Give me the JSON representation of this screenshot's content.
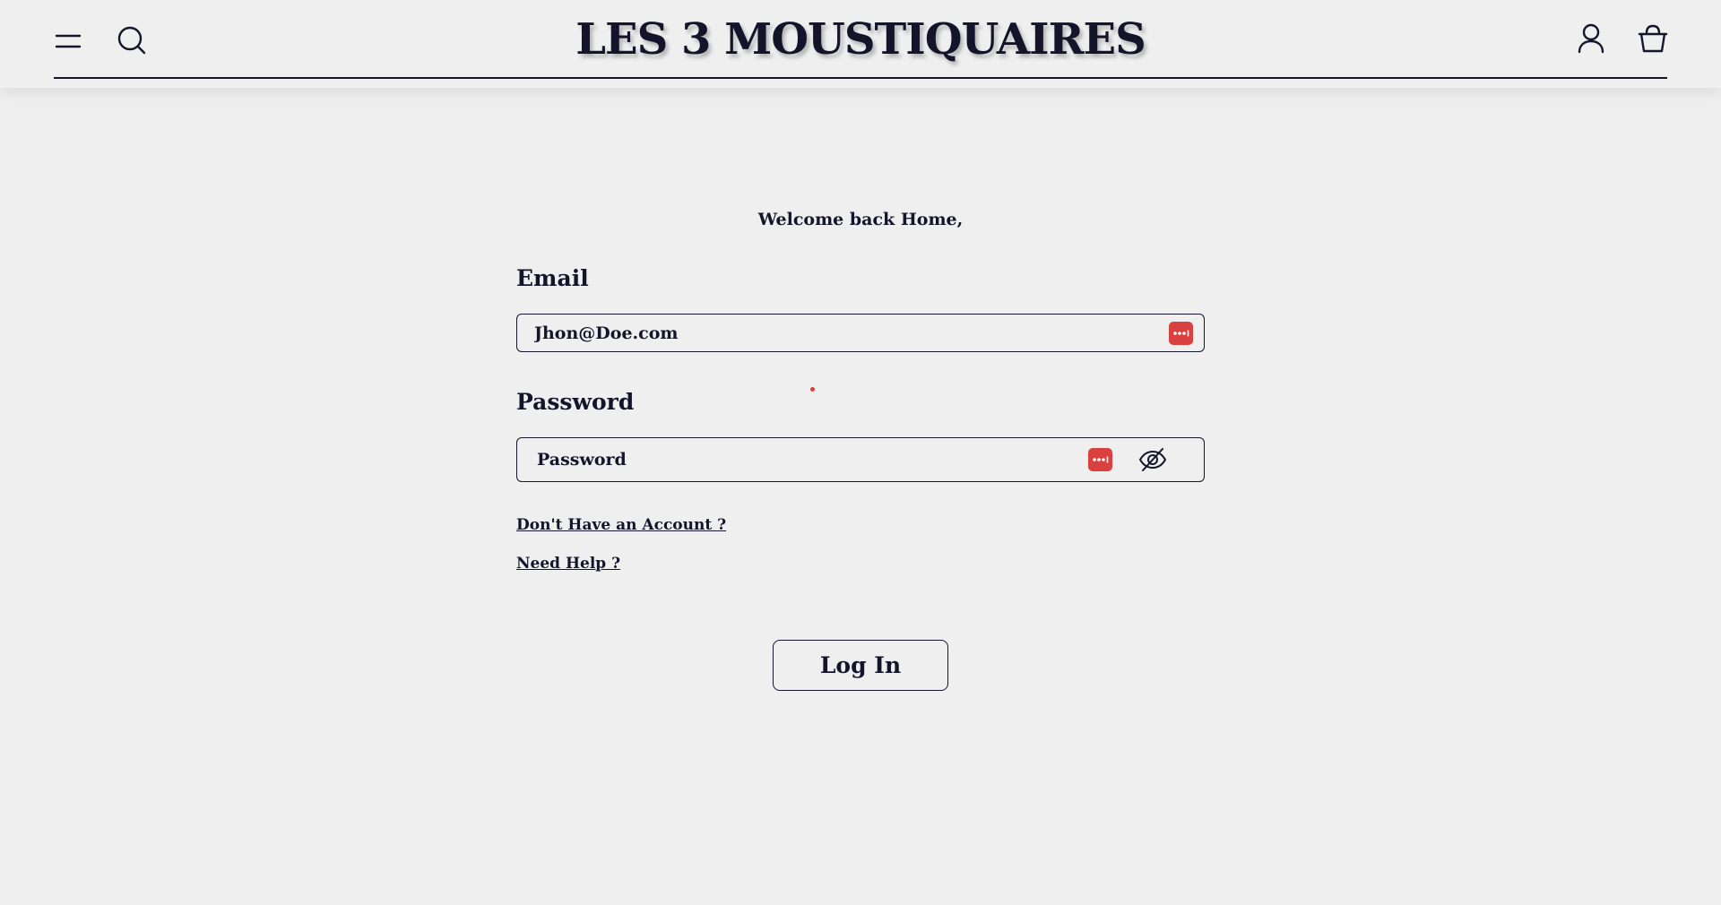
{
  "header": {
    "logo_text": "LES 3 MOUSTIQUAIRES",
    "icons": {
      "menu": "hamburger-menu-icon",
      "search": "search-icon",
      "account": "user-icon",
      "cart": "basket-icon"
    }
  },
  "login": {
    "welcome": "Welcome back Home,",
    "email": {
      "label": "Email",
      "value": "Jhon@Doe.com"
    },
    "password": {
      "label": "Password",
      "placeholder": "Password"
    },
    "links": {
      "no_account": "Don't Have an Account ?",
      "need_help": "Need Help ?"
    },
    "submit_label": "Log In"
  },
  "colors": {
    "background": "#efefef",
    "text": "#14142b",
    "password_manager_accent": "#d8413f"
  }
}
